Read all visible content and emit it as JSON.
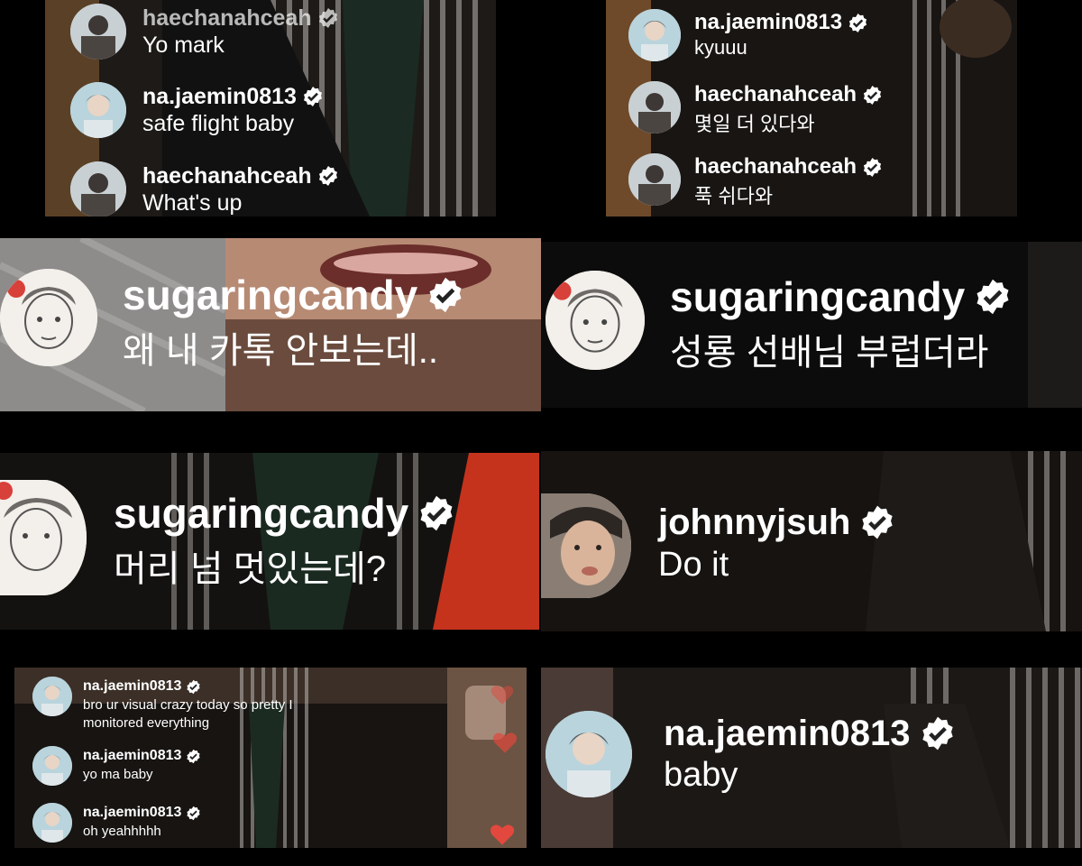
{
  "colors": {
    "verified_badge": "#ffffff",
    "heart": "#e2483d",
    "text": "#ffffff"
  },
  "panels": {
    "p1": {
      "comments": [
        {
          "user": "haechanahceah",
          "text": "Yo mark",
          "avatar": "photo-avatar"
        },
        {
          "user": "na.jaemin0813",
          "text": "safe flight baby",
          "avatar": "photo-avatar"
        },
        {
          "user": "haechanahceah",
          "text": "What's up",
          "avatar": "photo-avatar"
        }
      ]
    },
    "p2": {
      "comments": [
        {
          "user": "na.jaemin0813",
          "text": "kyuuu",
          "avatar": "photo-avatar"
        },
        {
          "user": "haechanahceah",
          "text": "몇일 더 있다와",
          "avatar": "photo-avatar"
        },
        {
          "user": "haechanahceah",
          "text": "푹 쉬다와",
          "avatar": "photo-avatar"
        }
      ]
    },
    "p3": {
      "comments": [
        {
          "user": "sugaringcandy",
          "text": "왜 내 카톡 안보는데..",
          "avatar": "sketch-avatar"
        }
      ]
    },
    "p4": {
      "comments": [
        {
          "user": "sugaringcandy",
          "text": "성룡 선배님 부럽더라",
          "avatar": "sketch-avatar"
        }
      ]
    },
    "p5": {
      "comments": [
        {
          "user": "sugaringcandy",
          "text": "머리 넘 멋있는데?",
          "avatar": "sketch-avatar"
        }
      ]
    },
    "p6": {
      "comments": [
        {
          "user": "johnnyjsuh",
          "text": "Do it",
          "avatar": "photo-avatar"
        }
      ]
    },
    "p7": {
      "comments": [
        {
          "user": "na.jaemin0813",
          "text": "bro ur visual crazy today so pretty I",
          "text2": "monitored everything",
          "avatar": "photo-avatar"
        },
        {
          "user": "na.jaemin0813",
          "text": "yo ma baby",
          "avatar": "photo-avatar"
        },
        {
          "user": "na.jaemin0813",
          "text": "oh yeahhhhh",
          "avatar": "photo-avatar"
        }
      ]
    },
    "p8": {
      "comments": [
        {
          "user": "na.jaemin0813",
          "text": "baby",
          "avatar": "photo-avatar"
        }
      ]
    }
  }
}
